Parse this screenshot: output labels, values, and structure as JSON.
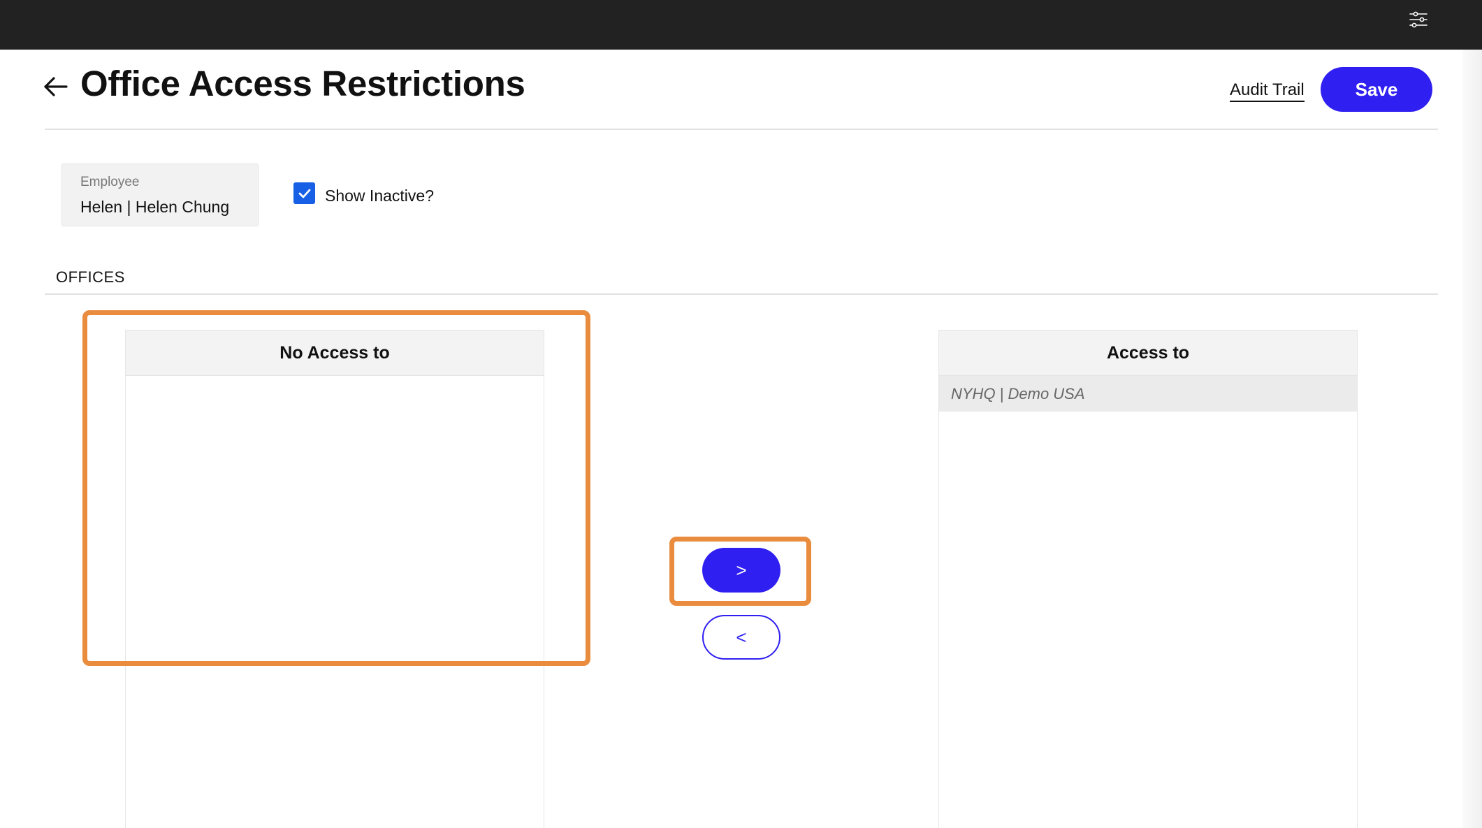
{
  "topbar": {
    "settings_icon": "sliders-icon"
  },
  "header": {
    "back_icon": "arrow-left-icon",
    "title": "Office Access Restrictions",
    "audit_trail_label": "Audit Trail",
    "save_label": "Save"
  },
  "filters": {
    "employee_label": "Employee",
    "employee_value": "Helen | Helen Chung",
    "show_inactive_label": "Show Inactive?",
    "show_inactive_checked": true
  },
  "offices": {
    "section_label": "OFFICES",
    "no_access": {
      "header": "No Access to",
      "items": []
    },
    "access": {
      "header": "Access to",
      "items": [
        "NYHQ | Demo USA"
      ]
    },
    "move_right_label": ">",
    "move_left_label": "<"
  },
  "colors": {
    "topbar": "#222222",
    "accent": "#2f1ff0",
    "checkbox": "#1760e6",
    "highlight": "#ea8c3e"
  }
}
